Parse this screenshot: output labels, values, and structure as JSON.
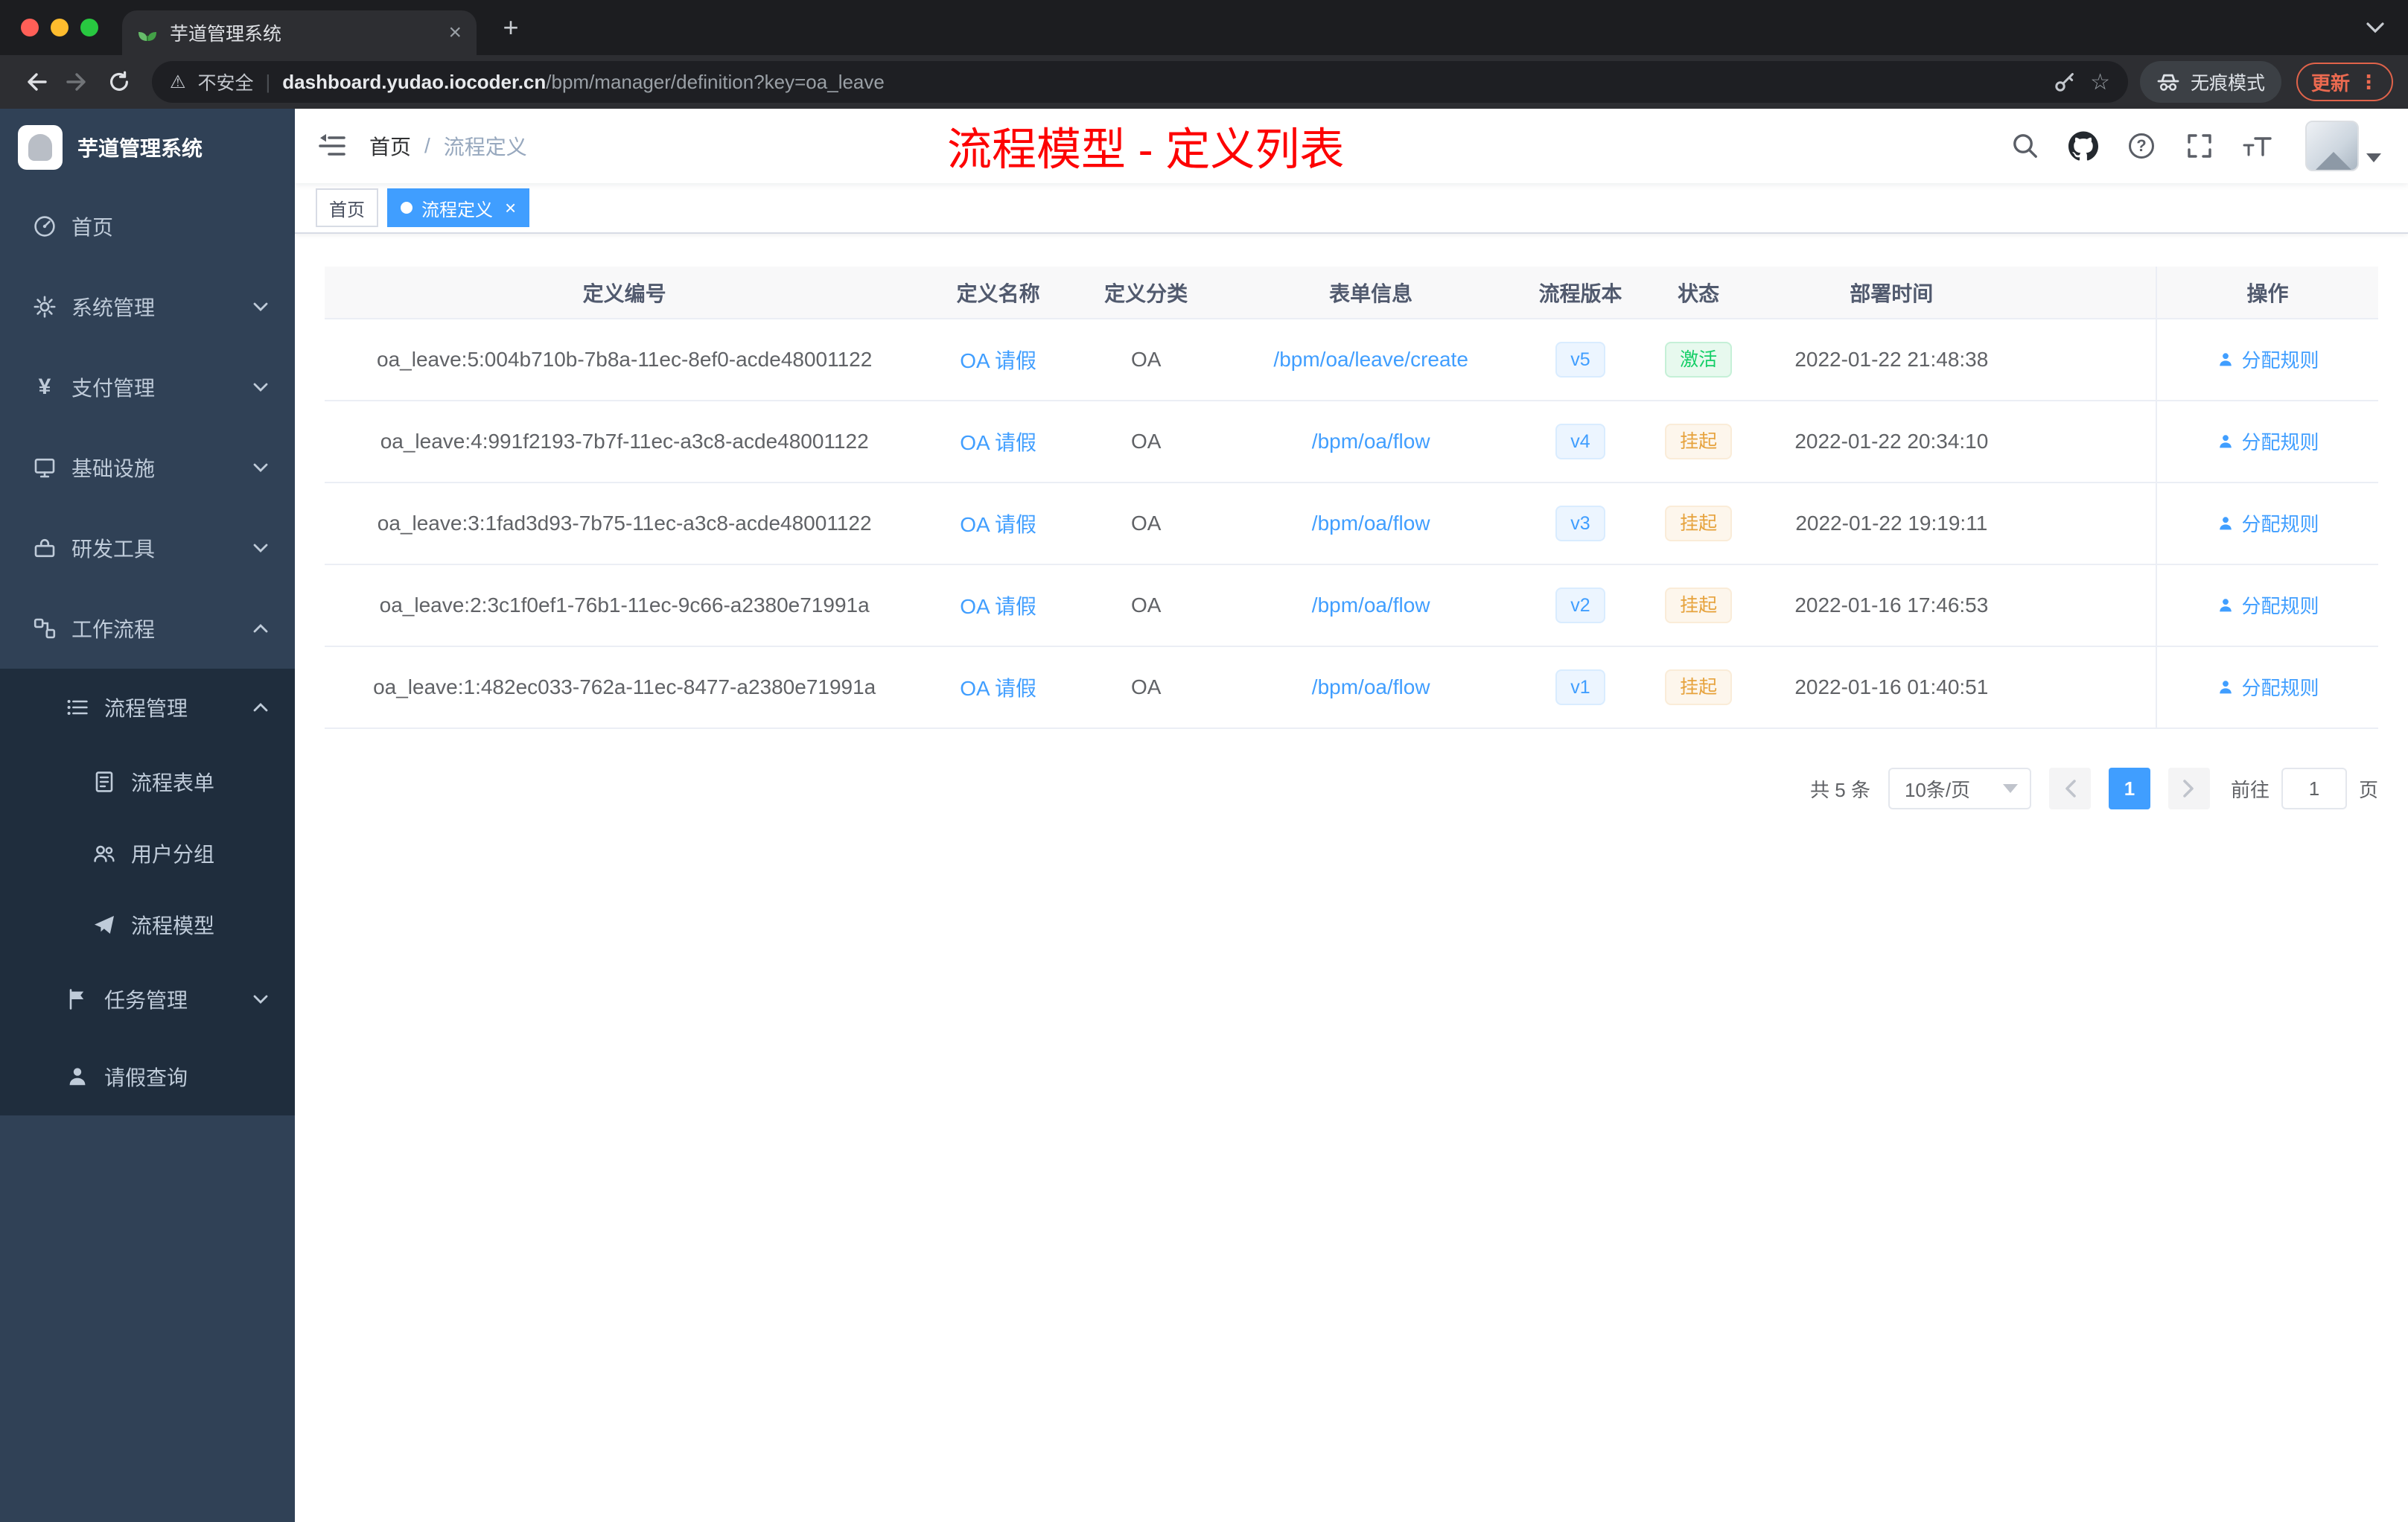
{
  "browser": {
    "tab": {
      "title": "芋道管理系统"
    },
    "toolbar": {
      "security_label": "不安全",
      "url_host": "dashboard.yudao.iocoder.cn",
      "url_path": "/bpm/manager/definition?key=oa_leave",
      "incognito_label": "无痕模式",
      "update_label": "更新"
    }
  },
  "icons": {
    "close": "×",
    "plus": "+",
    "warning": "⚠",
    "separator": "|",
    "star": "☆",
    "dots": "⋮",
    "yen": "¥",
    "question": "?"
  },
  "sidebar": {
    "app_title": "芋道管理系统",
    "items": [
      {
        "label": "首页"
      },
      {
        "label": "系统管理"
      },
      {
        "label": "支付管理"
      },
      {
        "label": "基础设施"
      },
      {
        "label": "研发工具"
      },
      {
        "label": "工作流程"
      },
      {
        "label": "流程管理"
      },
      {
        "label": "流程表单"
      },
      {
        "label": "用户分组"
      },
      {
        "label": "流程模型"
      },
      {
        "label": "任务管理"
      },
      {
        "label": "请假查询"
      }
    ]
  },
  "header": {
    "breadcrumb": {
      "home": "首页",
      "separator": "/",
      "current": "流程定义"
    },
    "annotation": "流程模型 - 定义列表"
  },
  "tags": {
    "items": [
      {
        "label": "首页",
        "active": false
      },
      {
        "label": "流程定义",
        "active": true
      }
    ]
  },
  "table": {
    "columns": [
      "定义编号",
      "定义名称",
      "定义分类",
      "表单信息",
      "流程版本",
      "状态",
      "部署时间",
      "操作"
    ],
    "rows": [
      {
        "id": "oa_leave:5:004b710b-7b8a-11ec-8ef0-acde48001122",
        "name": "OA 请假",
        "category": "OA",
        "form": "/bpm/oa/leave/create",
        "version": "v5",
        "status": "激活",
        "time": "2022-01-22 21:48:38",
        "action": "分配规则"
      },
      {
        "id": "oa_leave:4:991f2193-7b7f-11ec-a3c8-acde48001122",
        "name": "OA 请假",
        "category": "OA",
        "form": "/bpm/oa/flow",
        "version": "v4",
        "status": "挂起",
        "time": "2022-01-22 20:34:10",
        "action": "分配规则"
      },
      {
        "id": "oa_leave:3:1fad3d93-7b75-11ec-a3c8-acde48001122",
        "name": "OA 请假",
        "category": "OA",
        "form": "/bpm/oa/flow",
        "version": "v3",
        "status": "挂起",
        "time": "2022-01-22 19:19:11",
        "action": "分配规则"
      },
      {
        "id": "oa_leave:2:3c1f0ef1-76b1-11ec-9c66-a2380e71991a",
        "name": "OA 请假",
        "category": "OA",
        "form": "/bpm/oa/flow",
        "version": "v2",
        "status": "挂起",
        "time": "2022-01-16 17:46:53",
        "action": "分配规则"
      },
      {
        "id": "oa_leave:1:482ec033-762a-11ec-8477-a2380e71991a",
        "name": "OA 请假",
        "category": "OA",
        "form": "/bpm/oa/flow",
        "version": "v1",
        "status": "挂起",
        "time": "2022-01-16 01:40:51",
        "action": "分配规则"
      }
    ]
  },
  "pagination": {
    "total": "共 5 条",
    "page_size": "10条/页",
    "current_page": "1",
    "goto_label": "前往",
    "goto_value": "1",
    "unit_label": "页"
  },
  "colors": {
    "accent": "#409eff",
    "annotation": "#fd0202",
    "success": "#13ce66",
    "warning": "#e6a23c",
    "sidebar_bg": "#304156",
    "submenu_bg": "#1f2d3d"
  }
}
